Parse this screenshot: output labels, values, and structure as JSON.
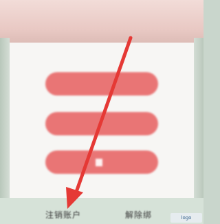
{
  "dialog": {
    "button1_label": "",
    "button2_label": "",
    "button3_label": ""
  },
  "bottom_bar": {
    "left_label": "注销账户",
    "right_label": "解除绑"
  },
  "annotation": {
    "arrow_color": "#e53935"
  },
  "watermark": {
    "text": "logo"
  }
}
